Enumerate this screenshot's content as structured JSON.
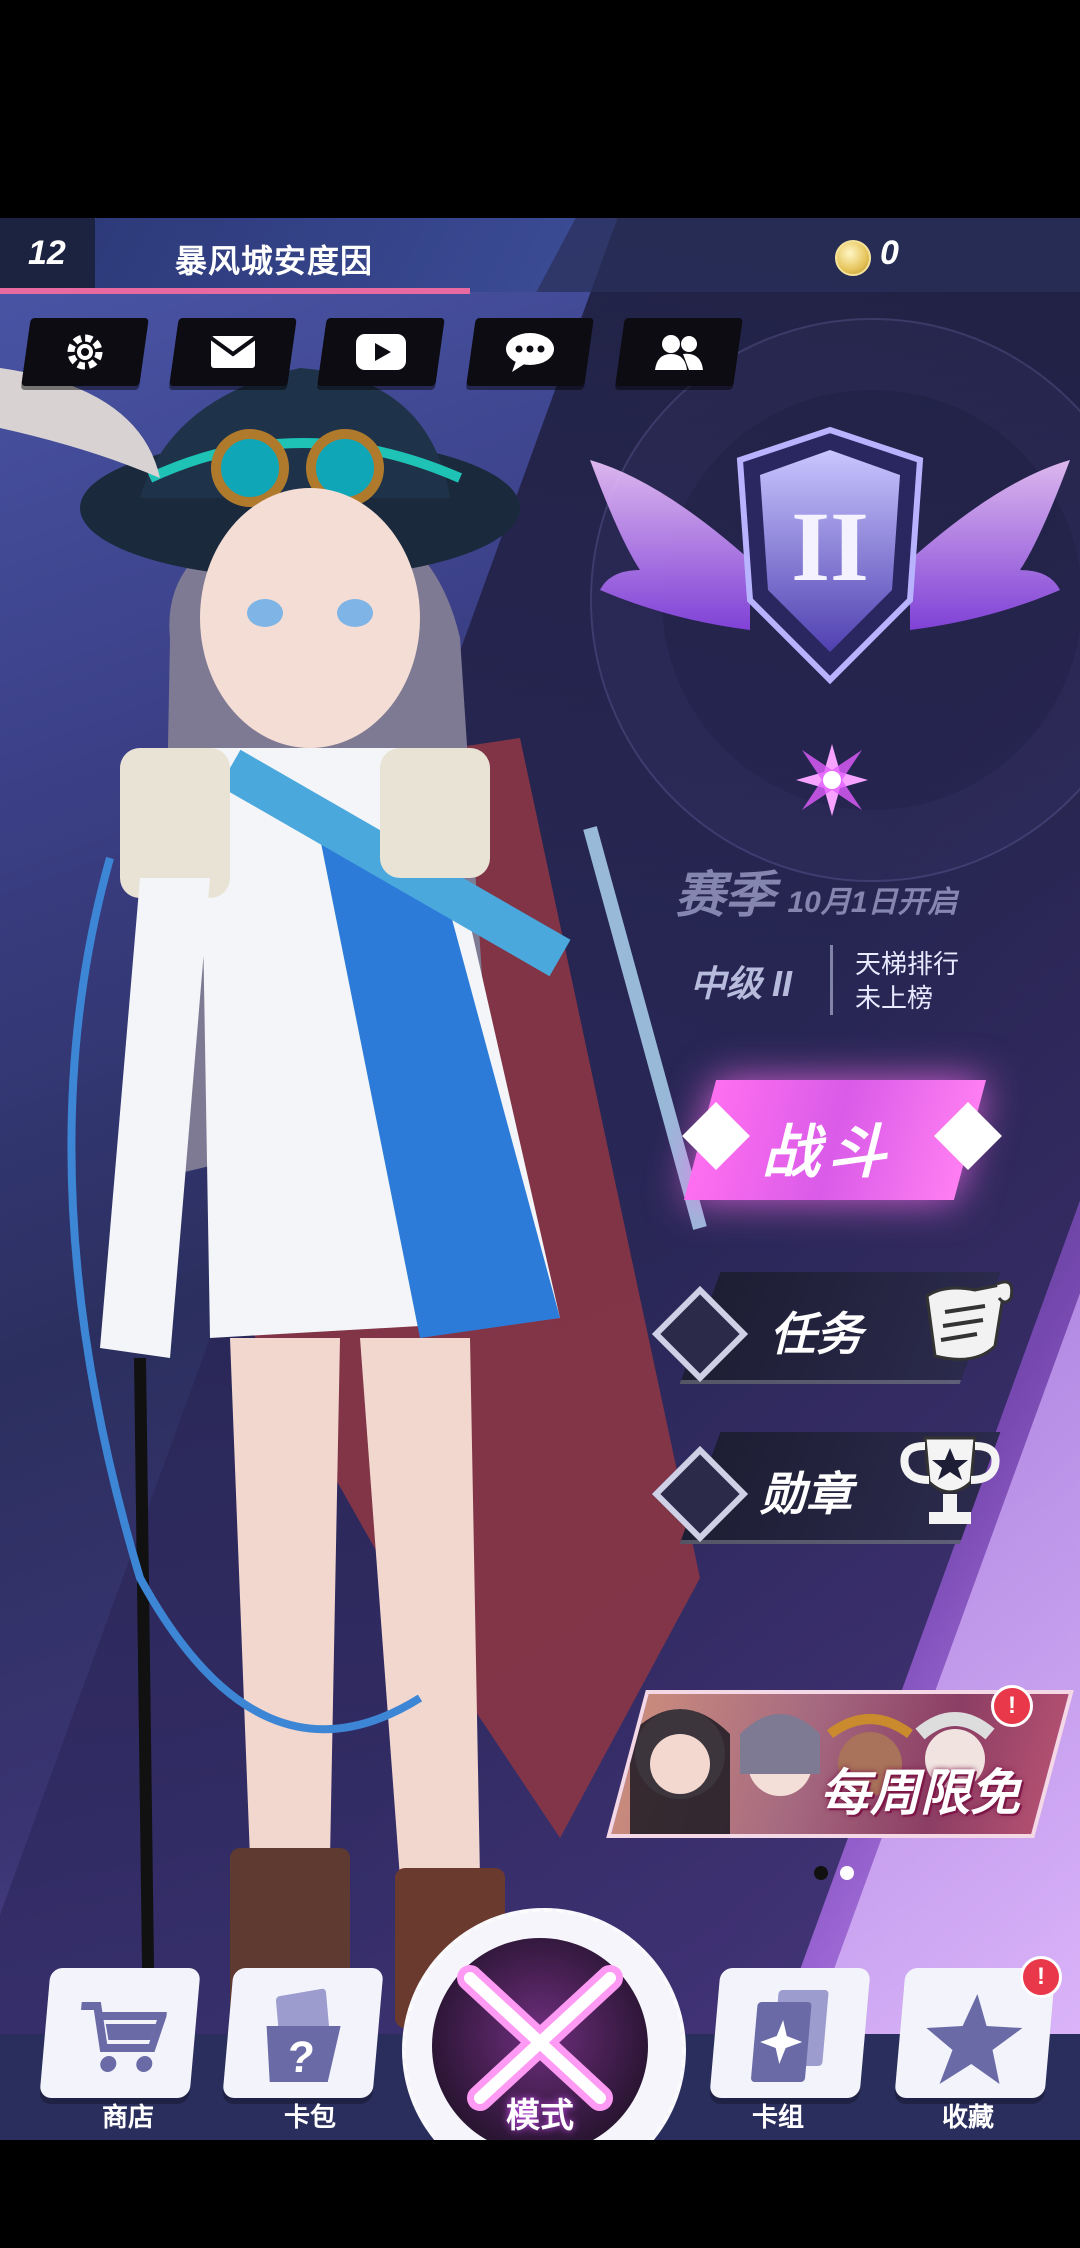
{
  "header": {
    "level": "12",
    "player_name": "暴风城安度因",
    "coins": "0"
  },
  "toolbar": [
    {
      "icon": "gear-icon"
    },
    {
      "icon": "mail-icon"
    },
    {
      "icon": "video-icon"
    },
    {
      "icon": "chat-icon"
    },
    {
      "icon": "friends-icon"
    }
  ],
  "rank": {
    "emblem_numeral": "II",
    "season_label": "赛季",
    "season_start": "10月1日开启",
    "tier": "中级 II",
    "ladder_line1": "天梯排行",
    "ladder_line2": "未上榜"
  },
  "actions": {
    "battle": "战斗",
    "quests": "任务",
    "medals": "勋章"
  },
  "banner": {
    "label": "每周限免",
    "alert": "!"
  },
  "pager": {
    "count": 2,
    "active": 1
  },
  "nav": {
    "shop": "商店",
    "packs": "卡包",
    "mode": "模式",
    "decks": "卡组",
    "collection": "收藏",
    "collection_alert": "!"
  },
  "colors": {
    "accent_pink": "#ff6ff0",
    "alert_red": "#e8384a",
    "nav_bg": "#2a2e5c"
  }
}
